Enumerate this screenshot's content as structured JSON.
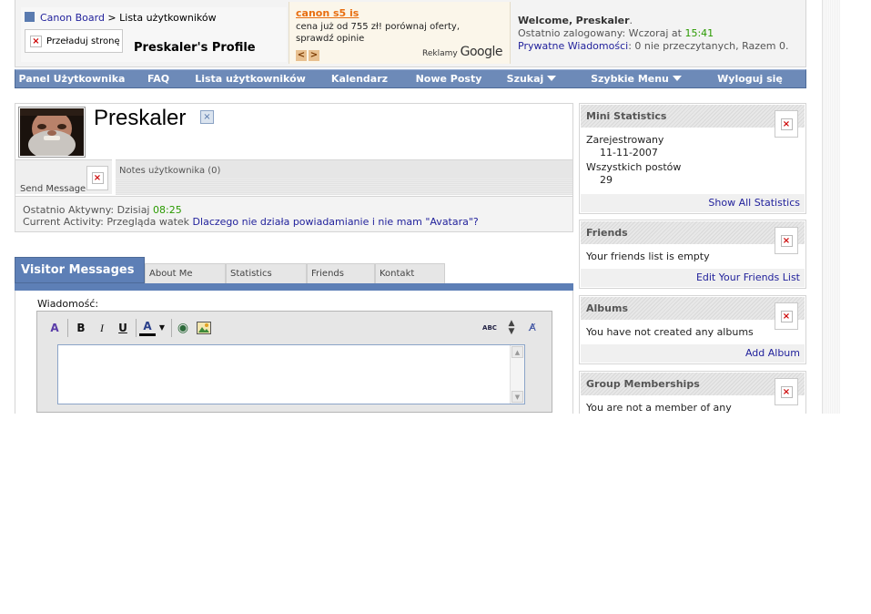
{
  "header": {
    "crumb_site": "Canon Board",
    "crumb_sep": ">",
    "crumb_page": "Lista użytkowników",
    "reload_label": "Przeładuj stronę",
    "profile_title": "Preskaler's Profile"
  },
  "ad": {
    "title": "canon s5 is",
    "text": "cena już od 755 zł! porównaj oferty, sprawdź opinie",
    "prev": "<",
    "next": ">",
    "label": "Reklamy",
    "brand": "Google"
  },
  "welcome": {
    "greeting": "Welcome,",
    "username": "Preskaler",
    "last_login_label": "Ostatnio zalogowany: Wczoraj at",
    "last_login_time": "15:41",
    "pm_link": "Prywatne Wiadomości",
    "pm_text": ": 0 nie przeczytanych, Razem 0."
  },
  "nav": [
    "Panel Użytkownika",
    "FAQ",
    "Lista użytkowników",
    "Kalendarz",
    "Nowe Posty",
    "Szukaj",
    "Szybkie Menu",
    "Wyloguj się"
  ],
  "profile": {
    "username": "Preskaler",
    "send_message": "Send Message",
    "notes_label": "Notes użytkownika (0)",
    "last_active_label": "Ostatnio Aktywny: Dzisiaj",
    "last_active_time": "08:25",
    "activity_label": "Current Activity: Przegląda watek",
    "activity_link": "Dlaczego nie działa powiadamianie i nie mam \"Avatara\"?"
  },
  "tabs": {
    "active": "Visitor Messages",
    "items": [
      "About Me",
      "Statistics",
      "Friends",
      "Kontakt"
    ]
  },
  "editor": {
    "label": "Wiadomość:",
    "tools": {
      "bold": "B",
      "italic": "I",
      "underline": "U",
      "font_color": "A",
      "spell": "ABC"
    }
  },
  "sidebar": {
    "mini_stats": {
      "title": "Mini Statistics",
      "joined_label": "Zarejestrowany",
      "joined_value": "11-11-2007",
      "posts_label": "Wszystkich postów",
      "posts_value": "29",
      "link": "Show All Statistics"
    },
    "friends": {
      "title": "Friends",
      "text": "Your friends list is empty",
      "link": "Edit Your Friends List"
    },
    "albums": {
      "title": "Albums",
      "text": "You have not created any albums",
      "link": "Add Album"
    },
    "groups": {
      "title": "Group Memberships",
      "text": "You are not a member of any"
    }
  },
  "colors": {
    "nav_bg": "#6d8ab8",
    "tab_active": "#5d7fb6",
    "link": "#22229c",
    "time_green": "#2a9a00",
    "ad_title": "#e86e10"
  }
}
